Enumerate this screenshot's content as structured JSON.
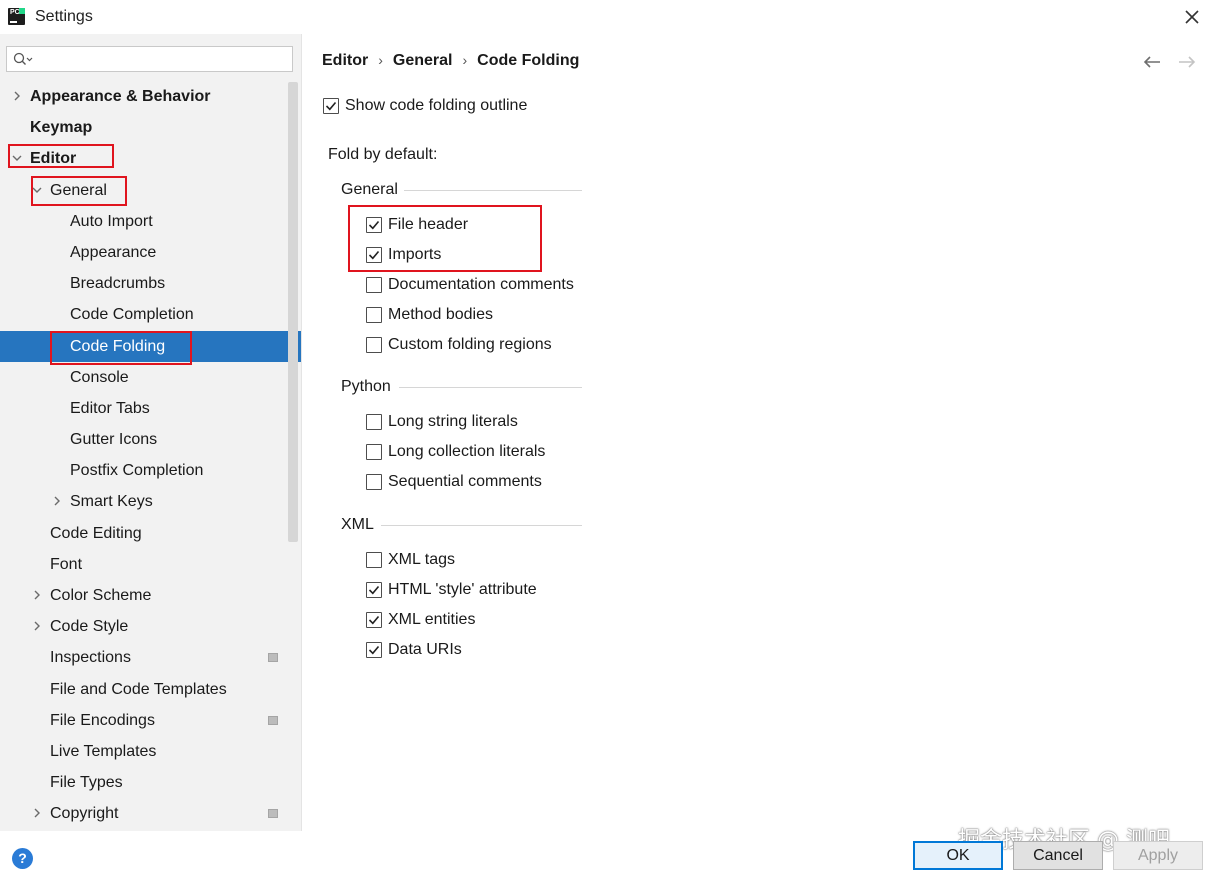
{
  "window": {
    "title": "Settings",
    "logo_text": "PC"
  },
  "search": {
    "placeholder": ""
  },
  "sidebar": {
    "items": [
      {
        "label": "Appearance & Behavior",
        "bold": true,
        "arrow": "right"
      },
      {
        "label": "Keymap",
        "bold": true,
        "arrow": "none"
      },
      {
        "label": "Editor",
        "bold": true,
        "arrow": "down"
      },
      {
        "label": "General",
        "bold": false,
        "arrow": "down"
      },
      {
        "label": "Auto Import"
      },
      {
        "label": "Appearance"
      },
      {
        "label": "Breadcrumbs"
      },
      {
        "label": "Code Completion"
      },
      {
        "label": "Code Folding",
        "selected": true
      },
      {
        "label": "Console"
      },
      {
        "label": "Editor Tabs"
      },
      {
        "label": "Gutter Icons"
      },
      {
        "label": "Postfix Completion"
      },
      {
        "label": "Smart Keys",
        "arrow": "right"
      },
      {
        "label": "Code Editing"
      },
      {
        "label": "Font"
      },
      {
        "label": "Color Scheme",
        "arrow": "right"
      },
      {
        "label": "Code Style",
        "arrow": "right"
      },
      {
        "label": "Inspections",
        "badge": true
      },
      {
        "label": "File and Code Templates"
      },
      {
        "label": "File Encodings",
        "badge": true
      },
      {
        "label": "Live Templates"
      },
      {
        "label": "File Types"
      },
      {
        "label": "Copyright",
        "arrow": "right",
        "badge": true
      }
    ]
  },
  "breadcrumb": {
    "items": [
      "Editor",
      "General",
      "Code Folding"
    ],
    "separator": "›"
  },
  "content": {
    "show_outline": {
      "label": "Show code folding outline",
      "checked": true
    },
    "fold_by_default": "Fold by default:",
    "sections": [
      {
        "title": "General",
        "options": [
          {
            "label": "File header",
            "checked": true
          },
          {
            "label": "Imports",
            "checked": true
          },
          {
            "label": "Documentation comments",
            "checked": false
          },
          {
            "label": "Method bodies",
            "checked": false
          },
          {
            "label": "Custom folding regions",
            "checked": false
          }
        ]
      },
      {
        "title": "Python",
        "options": [
          {
            "label": "Long string literals",
            "checked": false
          },
          {
            "label": "Long collection literals",
            "checked": false
          },
          {
            "label": "Sequential comments",
            "checked": false
          }
        ]
      },
      {
        "title": "XML",
        "options": [
          {
            "label": "XML tags",
            "checked": false
          },
          {
            "label": "HTML 'style' attribute",
            "checked": true
          },
          {
            "label": "XML entities",
            "checked": true
          },
          {
            "label": "Data URIs",
            "checked": true
          }
        ]
      }
    ]
  },
  "footer": {
    "help": "?",
    "ok": "OK",
    "cancel": "Cancel",
    "apply": "Apply",
    "watermark": "掘金技术社区 @ 测吧"
  },
  "colors": {
    "selection": "#2675bf",
    "highlight_box": "#e0141e",
    "sidebar_bg": "#f2f2f2"
  }
}
